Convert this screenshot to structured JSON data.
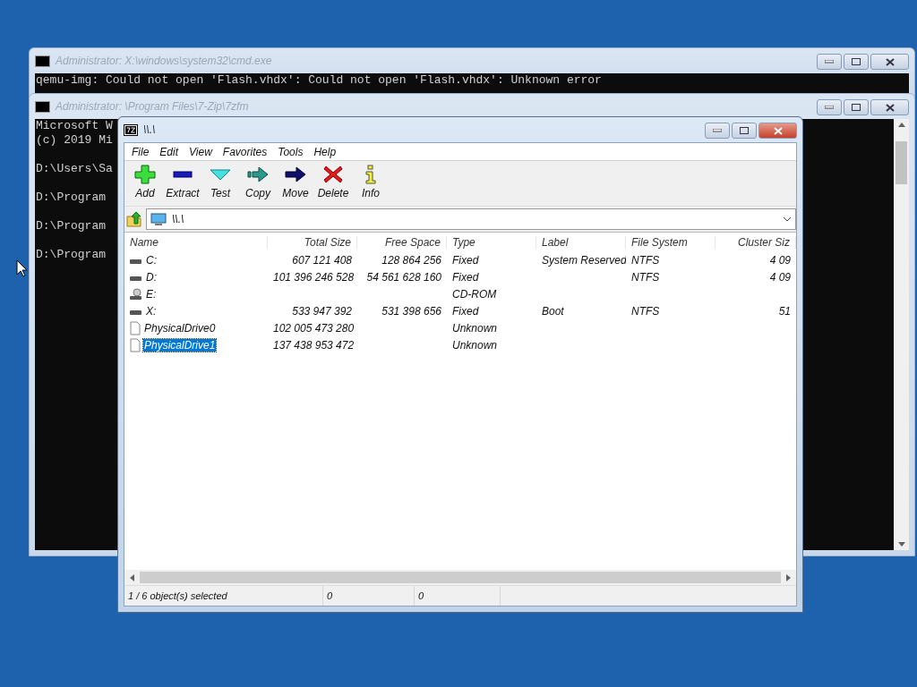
{
  "cmd_windows": [
    {
      "title": "Administrator: X:\\windows\\system32\\cmd.exe",
      "paragraphs": [
        [
          "qemu-img: Could not open 'Flash.vhdx': Could not open 'Flash.vhdx': Unknown error"
        ]
      ]
    },
    {
      "title": "Administrator: \\Program Files\\7-Zip\\7zfm",
      "paragraphs": [
        [
          "Microsoft W",
          "(c) 2019 Mi"
        ],
        [
          "D:\\Users\\Sa"
        ],
        [
          "D:\\Program"
        ],
        [
          "D:\\Program"
        ],
        [
          "D:\\Program"
        ]
      ]
    }
  ],
  "file_manager": {
    "title": "\\\\.\\",
    "menu": [
      "File",
      "Edit",
      "View",
      "Favorites",
      "Tools",
      "Help"
    ],
    "toolbar": [
      {
        "label": "Add",
        "kind": "add"
      },
      {
        "label": "Extract",
        "kind": "extract"
      },
      {
        "label": "Test",
        "kind": "test"
      },
      {
        "label": "Copy",
        "kind": "copy"
      },
      {
        "label": "Move",
        "kind": "move"
      },
      {
        "label": "Delete",
        "kind": "delete"
      },
      {
        "label": "Info",
        "kind": "info"
      }
    ],
    "address": "\\\\.\\",
    "columns": [
      {
        "label": "Name",
        "kind": "text"
      },
      {
        "label": "Total Size",
        "kind": "number"
      },
      {
        "label": "Free Space",
        "kind": "number"
      },
      {
        "label": "Type",
        "kind": "text"
      },
      {
        "label": "Label",
        "kind": "text"
      },
      {
        "label": "File System",
        "kind": "text"
      },
      {
        "label": "Cluster Siz",
        "kind": "number"
      }
    ],
    "rows": [
      {
        "kind": "drive",
        "selected": false,
        "cells": [
          "C:",
          "607 121 408",
          "128 864 256",
          "Fixed",
          "System Reserved",
          "NTFS",
          "4 09"
        ]
      },
      {
        "kind": "drive",
        "selected": false,
        "cells": [
          "D:",
          "101 396 246 528",
          "54 561 628 160",
          "Fixed",
          "",
          "NTFS",
          "4 09"
        ]
      },
      {
        "kind": "cdrom",
        "selected": false,
        "cells": [
          "E:",
          "",
          "",
          "CD-ROM",
          "",
          "",
          ""
        ]
      },
      {
        "kind": "drive",
        "selected": false,
        "cells": [
          "X:",
          "533 947 392",
          "531 398 656",
          "Fixed",
          "Boot",
          "NTFS",
          "51"
        ]
      },
      {
        "kind": "file",
        "selected": false,
        "cells": [
          "PhysicalDrive0",
          "102 005 473 280",
          "",
          "Unknown",
          "",
          "",
          ""
        ]
      },
      {
        "kind": "file",
        "selected": true,
        "cells": [
          "PhysicalDrive1",
          "137 438 953 472",
          "",
          "Unknown",
          "",
          "",
          ""
        ]
      }
    ],
    "status": [
      "1 / 6 object(s) selected",
      "0",
      "0"
    ]
  }
}
